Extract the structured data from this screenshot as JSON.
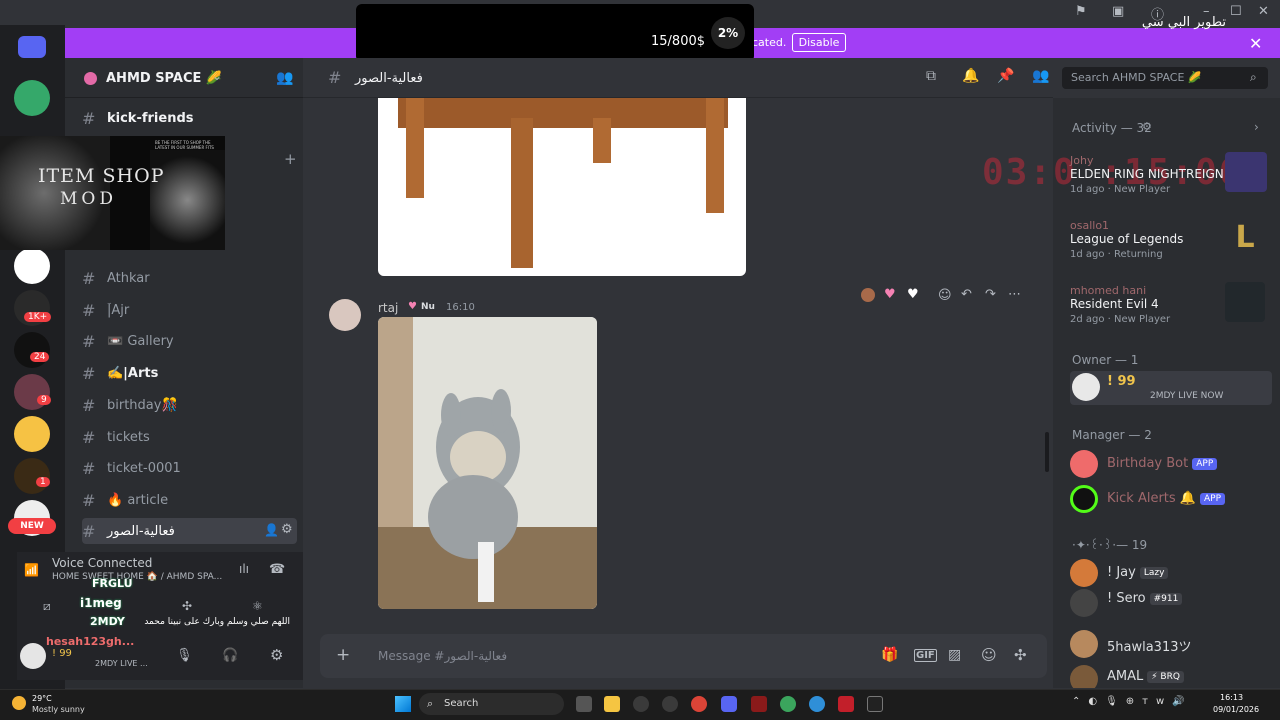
{
  "popup": {
    "title": "تطوير البي سي",
    "sub": "15/800$",
    "pct": "2%"
  },
  "banner": {
    "text": "cated.",
    "disable": "Disable"
  },
  "server": {
    "name": "AHMD SPACE 🌽"
  },
  "channels": [
    {
      "name": "kick-friends"
    },
    {
      "name": "Athkar"
    },
    {
      "name": "ؔ|Ajr"
    },
    {
      "name": "📼 Gallery"
    },
    {
      "name": "✍️|Arts"
    },
    {
      "name": "birthday🎊"
    },
    {
      "name": "tickets"
    },
    {
      "name": "ticket-0001"
    },
    {
      "name": "🔥 article"
    },
    {
      "name": "فعالية-الصور"
    }
  ],
  "itemshop": {
    "title": "ITEM SHOP",
    "sub": "MOD",
    "small": "BE THE FIRST TO SHOP THE LATEST IN OUR SUMMER FITS"
  },
  "rail": {
    "new": "NEW",
    "badges": [
      "1K+",
      "24",
      "9",
      "1"
    ]
  },
  "voice": {
    "status": "Voice Connected",
    "location": "HOME SWEET HOME 🏠 / AHMD SPA...",
    "users": [
      "FRGLU",
      "i1meg",
      "2MDY"
    ],
    "prayer": "اللهم صلي وسلم وبارك على نبينا محمد",
    "me": "hesah123gh...",
    "me_status": "! 99",
    "me_live": "2MDY LIVE ..."
  },
  "header": {
    "channel": "فعالية-الصور",
    "search": "Search AHMD SPACE 🌽"
  },
  "message": {
    "user": "rtaj",
    "badge": "Nu",
    "time": "16:10"
  },
  "composer": {
    "placeholder": "Message #فعالية-الصور"
  },
  "activity": {
    "label": "Activity — 32",
    "items": [
      {
        "user": "Johy",
        "game": "ELDEN RING NIGHTREIGN",
        "info": "1d ago · New Player"
      },
      {
        "user": "osallo1",
        "game": "League of Legends",
        "info": "1d ago · Returning"
      },
      {
        "user": "mhomed hani",
        "game": "Resident Evil 4",
        "info": "2d ago · New Player"
      }
    ],
    "timer": "03:0 :15:06"
  },
  "owner": {
    "label": "Owner — 1",
    "name": "! 99",
    "live": "2MDY LIVE NOW"
  },
  "manager": {
    "label": "Manager — 2",
    "members": [
      {
        "name": "Birthday Bot",
        "tag": "APP"
      },
      {
        "name": "Kick Alerts 🔔",
        "tag": "APP"
      }
    ]
  },
  "group": {
    "label": "·✦·꒰·꒱·— 19",
    "members": [
      {
        "name": "! Jay",
        "tag": "Lazy"
      },
      {
        "name": "! Sero",
        "tag": "#911"
      },
      {
        "name": "5hawla313ツ",
        "tag": ""
      },
      {
        "name": "AMAL",
        "tag": "⚡ BRQ"
      }
    ]
  },
  "taskbar": {
    "weather_temp": "29°C",
    "weather_desc": "Mostly sunny",
    "search": "Search",
    "time": "16:13",
    "date": "09/01/2026"
  }
}
